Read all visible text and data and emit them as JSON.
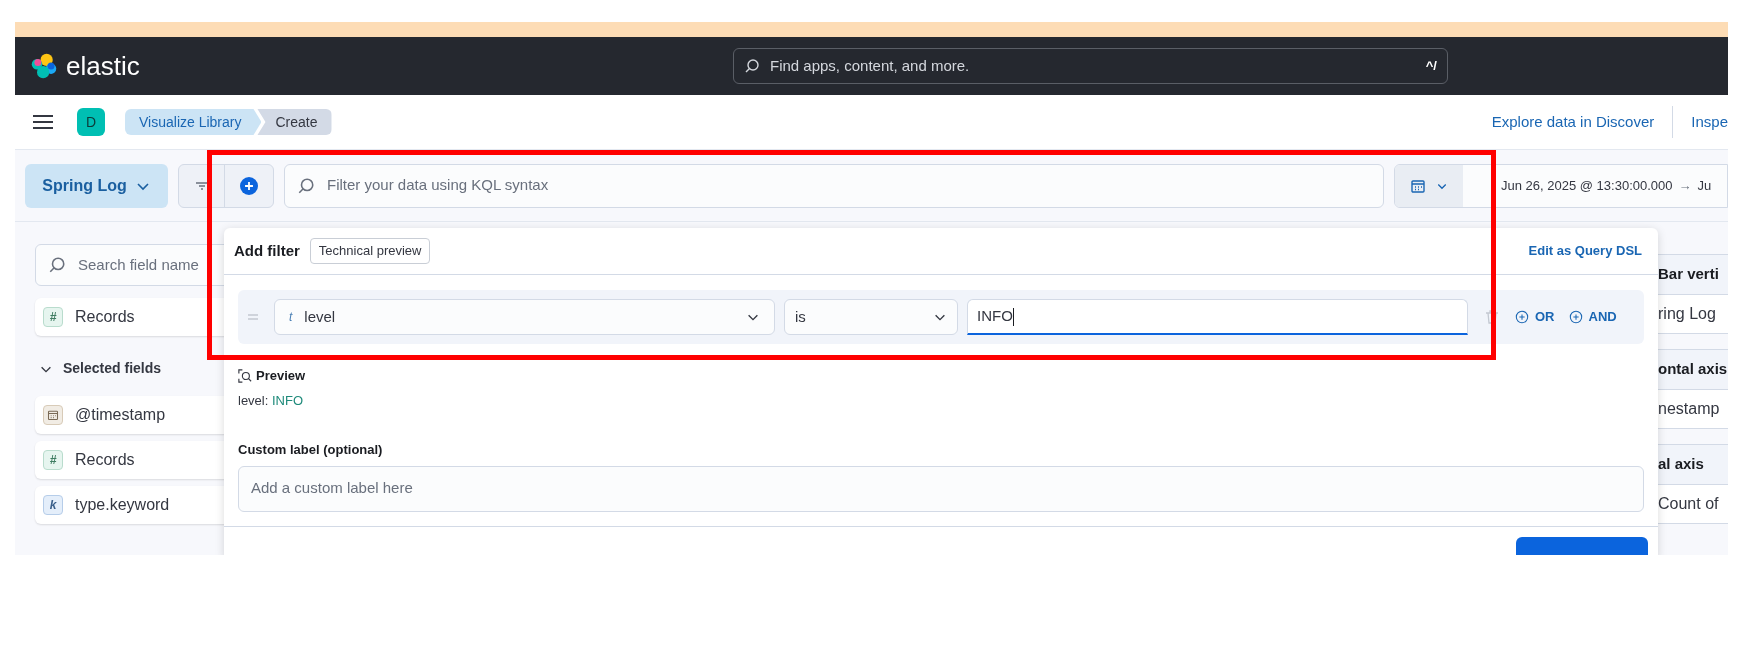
{
  "top_bar": {
    "logo_text": "elastic",
    "search": {
      "placeholder": "Find apps, content, and more.",
      "shortcut": "^/"
    }
  },
  "nav": {
    "avatar": "D",
    "breadcrumbs": [
      {
        "label": "Visualize Library",
        "selected": false
      },
      {
        "label": "Create",
        "selected": true
      }
    ],
    "actions": [
      "Explore data in Discover",
      "Inspe"
    ]
  },
  "query_bar": {
    "data_view": "Spring Log",
    "query": {
      "placeholder": "Filter your data using KQL syntax"
    },
    "time": {
      "start": "Jun 26, 2025 @ 13:30:00.000",
      "arrow": "→",
      "end": "Ju"
    }
  },
  "sidebar": {
    "search": {
      "placeholder": "Search field name"
    },
    "fields": [
      {
        "kind": "number",
        "type_badge": "#",
        "name": "Records"
      }
    ],
    "section": {
      "title": "Selected fields",
      "expanded": true
    },
    "selected_fields": [
      {
        "kind": "date",
        "name": "@timestamp"
      },
      {
        "kind": "number",
        "type_badge": "#",
        "name": "Records"
      },
      {
        "kind": "keyword",
        "type_badge": "k",
        "name": "type.keyword"
      }
    ]
  },
  "filter_popover": {
    "title": "Add filter",
    "badge": "Technical preview",
    "edit_link": "Edit as Query DSL",
    "condition": {
      "field_type": "t",
      "field": "level",
      "operator": "is",
      "value": "INFO",
      "or_label": "OR",
      "and_label": "AND"
    },
    "preview": {
      "title": "Preview",
      "field": "level:",
      "value": "INFO"
    },
    "custom_label": {
      "label": "Custom label (optional)",
      "placeholder": "Add a custom label here"
    }
  },
  "right_panel": [
    {
      "kind": "heading",
      "text": "Bar verti"
    },
    {
      "kind": "value",
      "text": "ring Log"
    },
    {
      "kind": "heading",
      "text": "ontal axis"
    },
    {
      "kind": "value",
      "text": "nestamp"
    },
    {
      "kind": "heading",
      "text": "al axis"
    },
    {
      "kind": "value",
      "text": "Count of"
    }
  ]
}
